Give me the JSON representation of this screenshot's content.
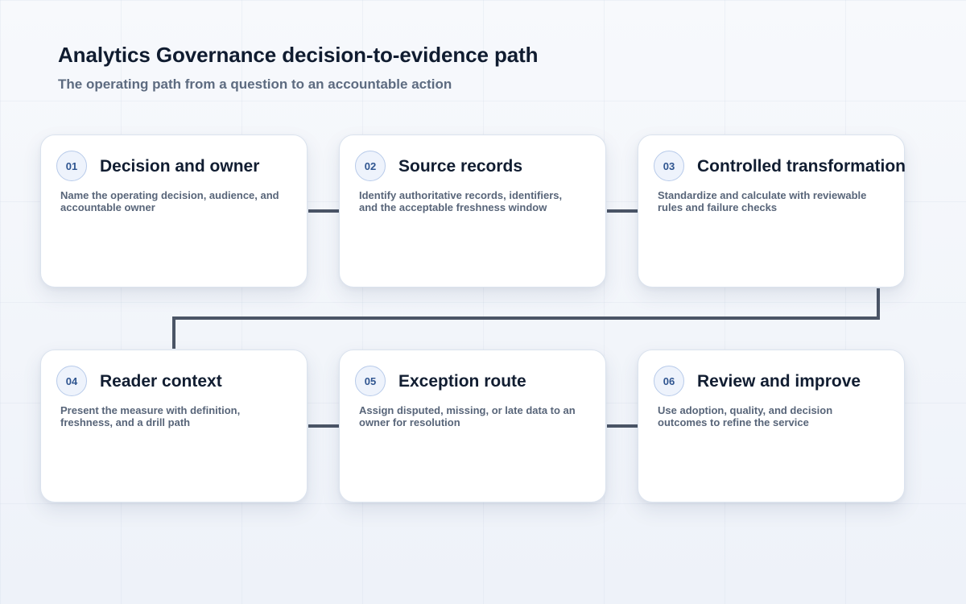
{
  "header": {
    "title": "Analytics Governance decision-to-evidence path",
    "subtitle": "The operating path from a question to an accountable action"
  },
  "steps": [
    {
      "number": "01",
      "title": "Decision and owner",
      "description": "Name the operating decision, audience, and accountable owner"
    },
    {
      "number": "02",
      "title": "Source records",
      "description": "Identify authoritative records, identifiers, and the acceptable freshness window"
    },
    {
      "number": "03",
      "title": "Controlled transformation",
      "description": "Standardize and calculate with reviewable rules and failure checks"
    },
    {
      "number": "04",
      "title": "Reader context",
      "description": "Present the measure with definition, freshness, and a drill path"
    },
    {
      "number": "05",
      "title": "Exception route",
      "description": "Assign disputed, missing, or late data to an owner for resolution"
    },
    {
      "number": "06",
      "title": "Review and improve",
      "description": "Use adoption, quality, and decision outcomes to refine the service"
    }
  ],
  "colors": {
    "connector": "#4b5566",
    "badge_text": "#2f5590",
    "badge_border": "#b8cbea"
  }
}
